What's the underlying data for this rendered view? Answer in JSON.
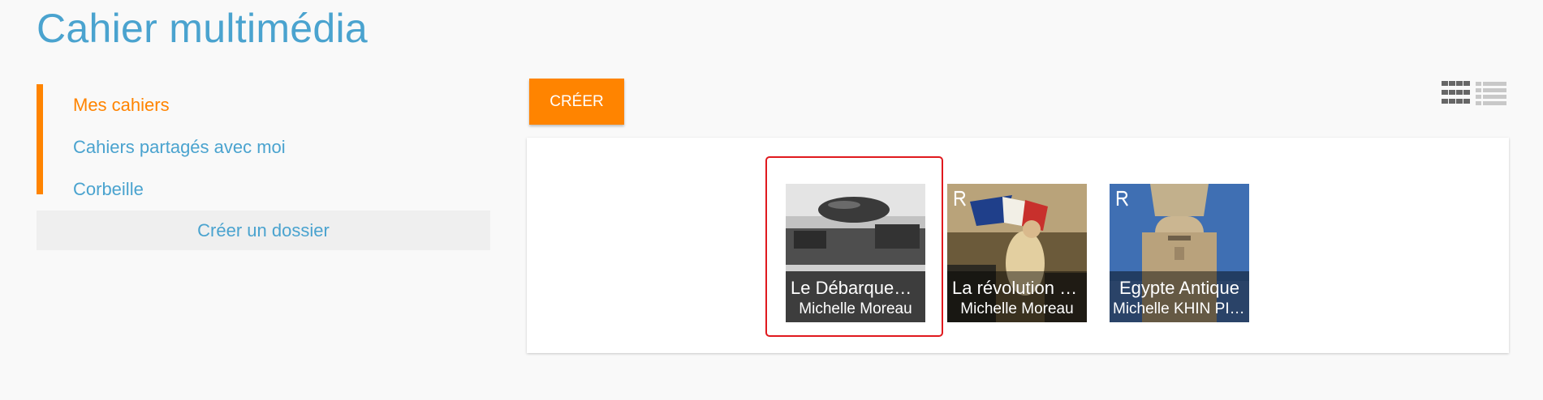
{
  "page": {
    "title": "Cahier multimédia"
  },
  "sidebar": {
    "items": [
      {
        "label": "Mes cahiers",
        "active": true
      },
      {
        "label": "Cahiers partagés avec moi",
        "active": false
      },
      {
        "label": "Corbeille",
        "active": false
      }
    ],
    "create_folder_label": "Créer un dossier"
  },
  "toolbar": {
    "create_label": "CRÉER",
    "views": [
      {
        "icon": "grid-view-icon",
        "active": true
      },
      {
        "icon": "list-view-icon",
        "active": false
      }
    ]
  },
  "notebooks": [
    {
      "title": "Le Débarquement",
      "author": "Michelle Moreau",
      "shared": false,
      "selected": true,
      "thumb": "landing-photo"
    },
    {
      "title": "La révolution française",
      "author": "Michelle Moreau",
      "shared": true,
      "selected": false,
      "thumb": "liberty-painting"
    },
    {
      "title": "Egypte Antique",
      "author": "Michelle KHIN PIEN",
      "shared": true,
      "selected": false,
      "thumb": "pharaoh-statue"
    }
  ],
  "colors": {
    "accent": "#ff8400",
    "link": "#4aa3cf",
    "selection": "#e0191e",
    "background": "#f9f9f9"
  }
}
